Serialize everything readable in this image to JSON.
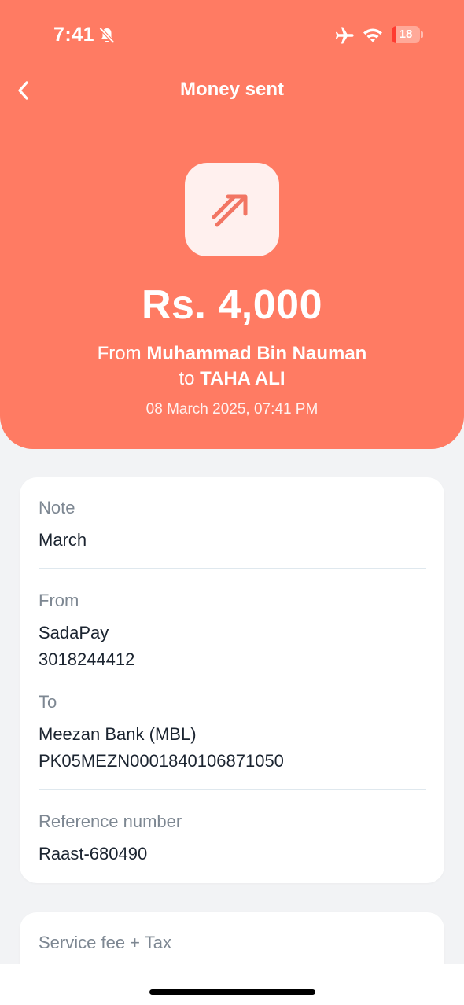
{
  "status_bar": {
    "time": "7:41",
    "battery": "18",
    "battery_level": 0.18,
    "icons": [
      "bell-slash-icon",
      "airplane-icon",
      "wifi-icon",
      "battery-icon"
    ]
  },
  "nav": {
    "title": "Money sent",
    "back_icon": "chevron-left-icon"
  },
  "summary": {
    "icon": "arrow-up-right-icon",
    "amount": "Rs. 4,000",
    "from_prefix": "From ",
    "from_name": "Muhammad Bin Nauman",
    "to_prefix": "to ",
    "to_name": "TAHA ALI",
    "datetime": "08 March 2025, 07:41 PM"
  },
  "details": {
    "note_label": "Note",
    "note_value": "March",
    "from_label": "From",
    "from_bank": "SadaPay",
    "from_account": "3018244412",
    "to_label": "To",
    "to_bank": "Meezan Bank (MBL)",
    "to_account": "PK05MEZN0001840106871050",
    "reference_label": "Reference number",
    "reference_value": "Raast-680490"
  },
  "fees": {
    "label": "Service fee + Tax"
  },
  "colors": {
    "header": "#ff7b63",
    "background": "#f2f3f5",
    "card": "#ffffff",
    "icon_box": "#fff0ee"
  }
}
